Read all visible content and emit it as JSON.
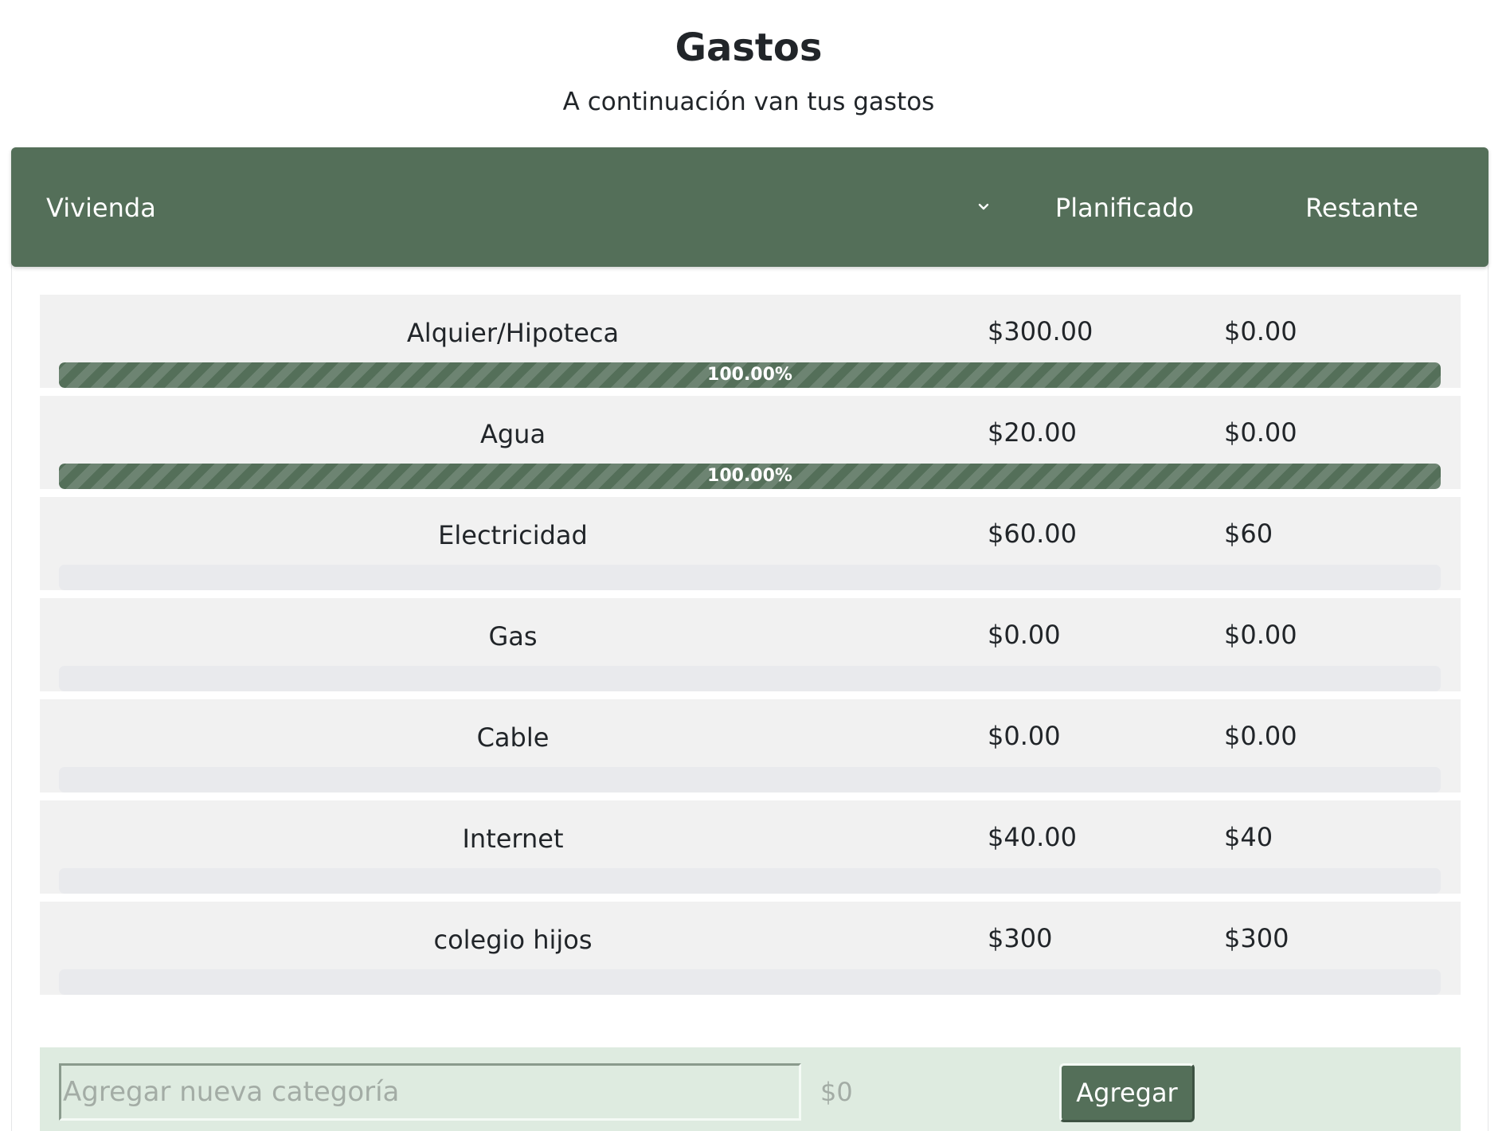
{
  "page": {
    "title": "Gastos",
    "subtitle": "A continuación van tus gastos"
  },
  "header": {
    "selected_category": "Vivienda",
    "dropdown_icon": "chevron-down-icon",
    "planned_label": "Planificado",
    "remaining_label": "Restante"
  },
  "items": [
    {
      "name": "Alquier/Hipoteca",
      "planned": "$300.00",
      "remaining": "$0.00",
      "progress": 1.0,
      "progress_label": "100.00%"
    },
    {
      "name": "Agua",
      "planned": "$20.00",
      "remaining": "$0.00",
      "progress": 1.0,
      "progress_label": "100.00%"
    },
    {
      "name": "Electricidad",
      "planned": "$60.00",
      "remaining": "$60",
      "progress": 0,
      "progress_label": ""
    },
    {
      "name": "Gas",
      "planned": "$0.00",
      "remaining": "$0.00",
      "progress": 0,
      "progress_label": ""
    },
    {
      "name": "Cable",
      "planned": "$0.00",
      "remaining": "$0.00",
      "progress": 0,
      "progress_label": ""
    },
    {
      "name": "Internet",
      "planned": "$40.00",
      "remaining": "$40",
      "progress": 0,
      "progress_label": ""
    },
    {
      "name": "colegio hijos",
      "planned": "$300",
      "remaining": "$300",
      "progress": 0,
      "progress_label": ""
    }
  ],
  "add_form": {
    "name_placeholder": "Agregar nueva categoría",
    "amount_placeholder": "$0",
    "button_label": "Agregar"
  },
  "colors": {
    "accent": "#546f59",
    "row_background": "#f1f1f1",
    "add_bar_background": "#deebe0"
  }
}
